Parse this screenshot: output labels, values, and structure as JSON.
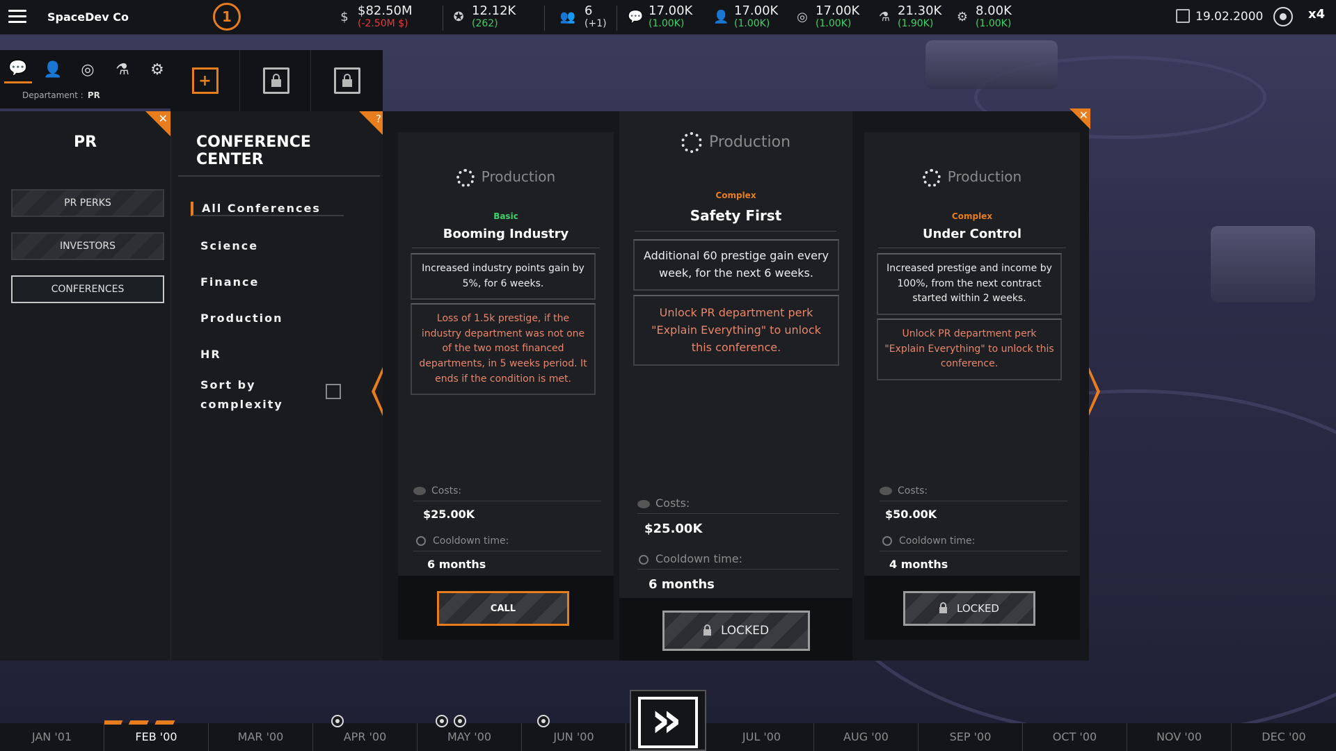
{
  "topbar": {
    "company": "SpaceDev Co",
    "level": "1",
    "resources": [
      {
        "icon": "money-icon",
        "value": "$82.50M",
        "delta": "(-2.50M $)",
        "trend": "negative"
      },
      {
        "icon": "prestige-icon",
        "value": "12.12K",
        "delta": "(262)",
        "trend": "positive"
      },
      {
        "icon": "employees-icon",
        "value": "6",
        "delta": "(+1)",
        "trend": "neutral"
      },
      {
        "icon": "pr-points-icon",
        "value": "17.00K",
        "delta": "(1.00K)",
        "trend": "positive"
      },
      {
        "icon": "hr-points-icon",
        "value": "17.00K",
        "delta": "(1.00K)",
        "trend": "positive"
      },
      {
        "icon": "finance-points-icon",
        "value": "17.00K",
        "delta": "(1.00K)",
        "trend": "positive"
      },
      {
        "icon": "science-points-icon",
        "value": "21.30K",
        "delta": "(1.90K)",
        "trend": "positive"
      },
      {
        "icon": "production-points-icon",
        "value": "8.00K",
        "delta": "(1.00K)",
        "trend": "positive"
      }
    ],
    "date": "19.02.2000",
    "speed": "x4"
  },
  "department": {
    "label": "Departament :",
    "value": "PR"
  },
  "pr_panel": {
    "title": "PR",
    "buttons": [
      "PR PERKS",
      "INVESTORS",
      "CONFERENCES"
    ],
    "active": "CONFERENCES"
  },
  "conference_center": {
    "title": "CONFERENCE CENTER",
    "help": "?",
    "filters": [
      "All Conferences",
      "Science",
      "Finance",
      "Production",
      "HR"
    ],
    "active_filter": "All Conferences",
    "sort_label": "Sort by complexity",
    "sort_checked": false
  },
  "cards": [
    {
      "category": "Production",
      "complexity": "Basic",
      "name": "Booming Industry",
      "effect": "Increased industry points gain by 5%, for 6 weeks.",
      "condition": "Loss of 1.5k prestige, if the industry department was not one of the two most financed departments, in 5 weeks period. It ends if the condition is met.",
      "costs_label": "Costs:",
      "cost": "$25.00K",
      "cooldown_label": "Cooldown time:",
      "cooldown": "6 months",
      "button": "CALL",
      "state": "available"
    },
    {
      "category": "Production",
      "complexity": "Complex",
      "name": "Safety First",
      "effect": "Additional 60 prestige gain every week, for the next 6 weeks.",
      "condition": "Unlock PR department perk \"Explain Everything\" to unlock this conference.",
      "costs_label": "Costs:",
      "cost": "$25.00K",
      "cooldown_label": "Cooldown time:",
      "cooldown": "6 months",
      "button": "LOCKED",
      "state": "locked"
    },
    {
      "category": "Production",
      "complexity": "Complex",
      "name": "Under Control",
      "effect": "Increased prestige and income by 100%, from the next contract started within 2 weeks.",
      "condition": "Unlock PR department perk \"Explain Everything\" to unlock this conference.",
      "costs_label": "Costs:",
      "cost": "$50.00K",
      "cooldown_label": "Cooldown time:",
      "cooldown": "4 months",
      "button": "LOCKED",
      "state": "locked"
    }
  ],
  "colors": {
    "accent": "#e87d1e",
    "basic": "#3fd06a",
    "complex": "#e87d1e",
    "warning": "#e9866c",
    "positive": "#3fd06a",
    "negative": "#e53a3a"
  },
  "timeline": {
    "months": [
      "JAN '01",
      "FEB '00",
      "MAR '00",
      "APR '00",
      "MAY '00",
      "JUN '00",
      "JUL '00",
      "AUG '00",
      "SEP '00",
      "OCT '00",
      "NOV '00",
      "DEC '00"
    ],
    "current": "FEB '00"
  }
}
